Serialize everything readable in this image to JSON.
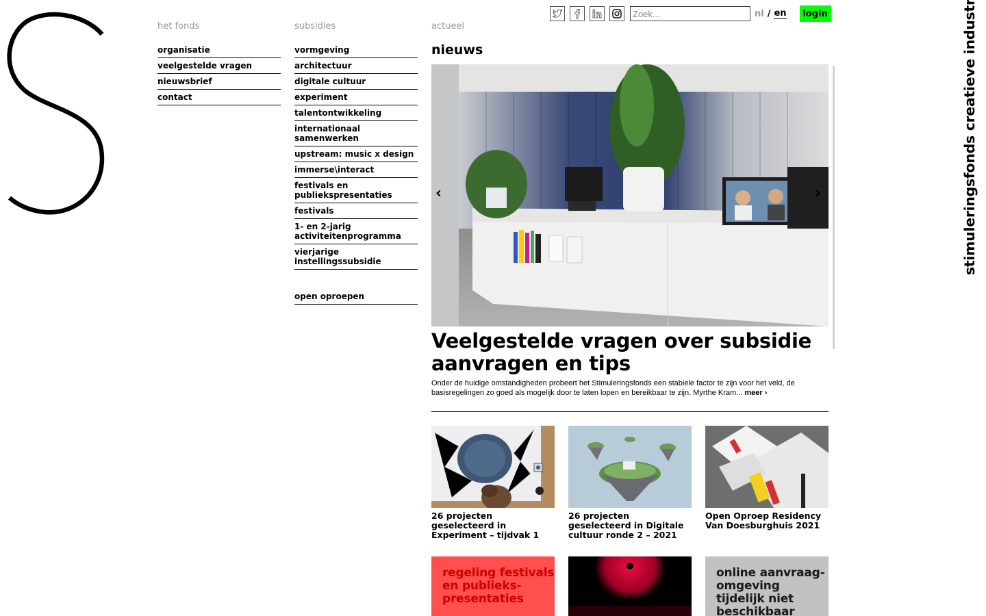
{
  "brand": {
    "vertical_name": "stimuleringsfonds creatieve industrie"
  },
  "topbar": {
    "social": [
      "twitter-icon",
      "facebook-icon",
      "linkedin-icon",
      "instagram-icon"
    ],
    "search_placeholder": "Zoek...",
    "lang_nl": "nl",
    "lang_sep": "/",
    "lang_en": "en",
    "login_label": "login",
    "login_color": "#00ff00"
  },
  "nav": {
    "fonds": {
      "heading": "het fonds",
      "items": [
        "organisatie",
        "veelgestelde vragen",
        "nieuwsbrief",
        "contact"
      ]
    },
    "subsidies": {
      "heading": "subsidies",
      "items": [
        "vormgeving",
        "architectuur",
        "digitale cultuur",
        "experiment",
        "talentontwikkeling",
        "internationaal samenwerken",
        "upstream: music x design",
        "immerse\\interact",
        "festivals en publiekspresentaties",
        "festivals",
        "1- en 2-jarig activiteitenprogramma",
        "vierjarige instellingssubsidie"
      ],
      "extra": "open oproepen"
    },
    "actueel": {
      "heading": "actueel"
    }
  },
  "news": {
    "section_title": "nieuws",
    "hero": {
      "title": "Veelgestelde vragen over subsidie aanvragen en tips",
      "text": "Onder de huidige omstandigheden probeert het Stimuleringsfonds een stabiele factor te zijn voor het veld, de basisregelingen zo goed als mogelijk door te laten lopen en bereikbaar te zijn. Myrthe Kram...",
      "more": "meer ›"
    },
    "cards": [
      {
        "title": "26 projecten geselecteerd in Experiment – tijdvak 1"
      },
      {
        "title": "26 projecten geselecteerd in Digitale cultuur ronde 2 – 2021"
      },
      {
        "title": "Open Oproep Residency Van Doesburghuis 2021"
      }
    ],
    "tiles": [
      {
        "text": "regeling festivals en publieks-presentaties",
        "bg": "#ff4f4f",
        "fg": "#d10000"
      },
      {
        "text": "",
        "bg": "#000000",
        "fg": "#ffffff"
      },
      {
        "text": "online aanvraag-omgeving tijdelijk niet beschikbaar",
        "bg": "#c2c2c2",
        "fg": "#1a1a1a"
      }
    ]
  }
}
